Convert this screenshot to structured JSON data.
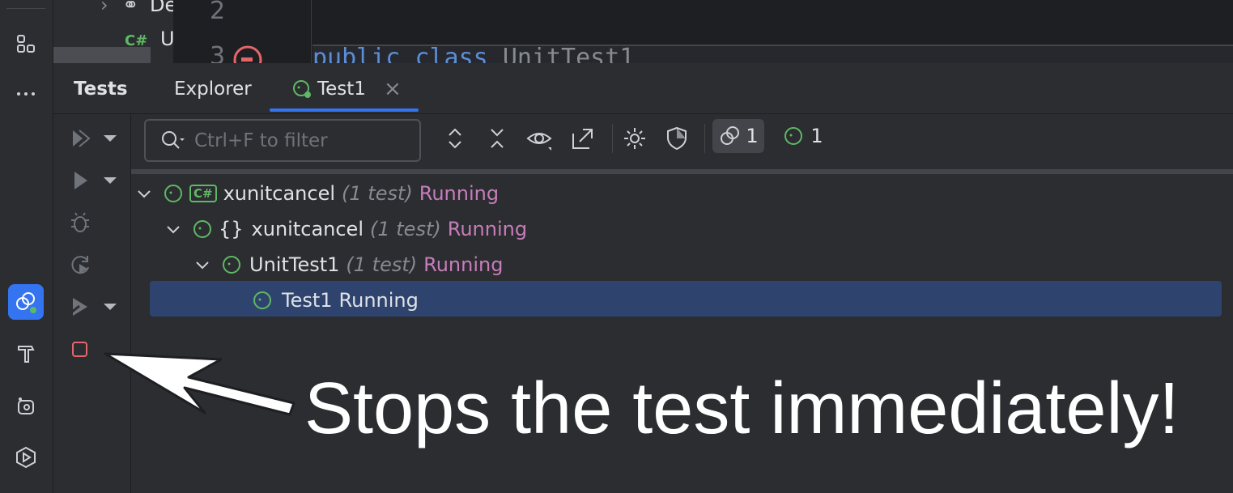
{
  "project_tree": {
    "item_1": "De",
    "item_2_icon": "C#",
    "item_2": "Ur"
  },
  "editor": {
    "line_numbers": [
      "2",
      "3"
    ],
    "code_keyword_1": "public",
    "code_keyword_2": "class",
    "code_class": "UnitTest1"
  },
  "tabs": [
    {
      "label": "Tests"
    },
    {
      "label": "Explorer"
    },
    {
      "label": "Test1"
    }
  ],
  "filter": {
    "placeholder": "Ctrl+F to filter"
  },
  "toolbar": {
    "running_count": "1",
    "passed_count": "1"
  },
  "tree": [
    {
      "name": "xunitcancel",
      "kind_badge": "C#",
      "meta": "(1 test)",
      "status": "Running"
    },
    {
      "name": "xunitcancel",
      "kind_badge": "{}",
      "meta": "(1 test)",
      "status": "Running"
    },
    {
      "name": "UnitTest1",
      "meta": "(1 test)",
      "status": "Running"
    },
    {
      "name": "Test1",
      "status": "Running"
    }
  ],
  "callout": {
    "text": "Stops the test immediately!"
  },
  "colors": {
    "accent": "#3574f0",
    "running": "#c77dbb",
    "stop": "#e5666a",
    "ok": "#5fb865"
  }
}
